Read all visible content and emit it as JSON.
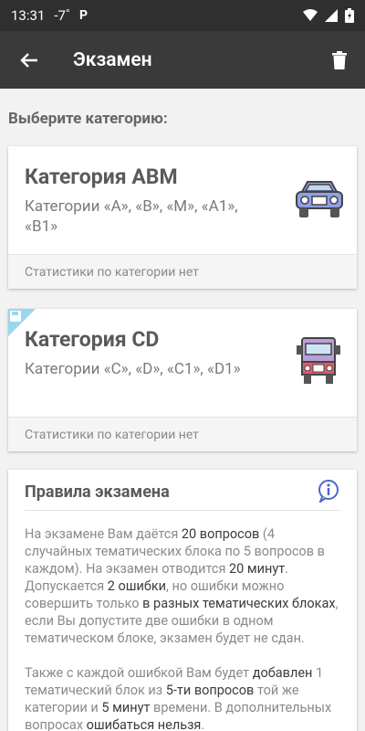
{
  "status": {
    "time": "13:31",
    "temp": "-7˚",
    "app_glyph": "P"
  },
  "appbar": {
    "title": "Экзамен"
  },
  "section_title": "Выберите категорию:",
  "cards": [
    {
      "title": "Категория ABM",
      "subtitle": "Категории «A», «B», «M», «A1», «B1»",
      "footer": "Статистики по категории нет",
      "icon": "car-icon"
    },
    {
      "title": "Категория CD",
      "subtitle": "Категории «C», «D», «C1», «D1»",
      "footer": "Статистики по категории нет",
      "icon": "truck-icon"
    }
  ],
  "rules": {
    "title": "Правила экзамена",
    "p1": [
      {
        "t": "На экзамене Вам даётся ",
        "h": false
      },
      {
        "t": "20 вопросов",
        "h": true
      },
      {
        "t": " (4 случайных тематических блока по 5 вопросов в каждом). На экзамен отводится ",
        "h": false
      },
      {
        "t": "20 минут",
        "h": true
      },
      {
        "t": ". Допускается ",
        "h": false
      },
      {
        "t": "2 ошибки",
        "h": true
      },
      {
        "t": ", но ошибки можно совершить только ",
        "h": false
      },
      {
        "t": "в разных тематических блоках",
        "h": true
      },
      {
        "t": ", если Вы допустите две ошибки в одном тематическом блоке, экзамен будет не сдан.",
        "h": false
      }
    ],
    "p2": [
      {
        "t": "Также с каждой ошибкой Вам будет ",
        "h": false
      },
      {
        "t": "добавлен",
        "h": true
      },
      {
        "t": " 1 тематический блок из ",
        "h": false
      },
      {
        "t": "5-ти вопросов",
        "h": true
      },
      {
        "t": " той же категории и ",
        "h": false
      },
      {
        "t": "5 минут",
        "h": true
      },
      {
        "t": " времени. В дополнительных вопросах ",
        "h": false
      },
      {
        "t": "ошибаться нельзя",
        "h": true
      },
      {
        "t": ".",
        "h": false
      }
    ]
  }
}
